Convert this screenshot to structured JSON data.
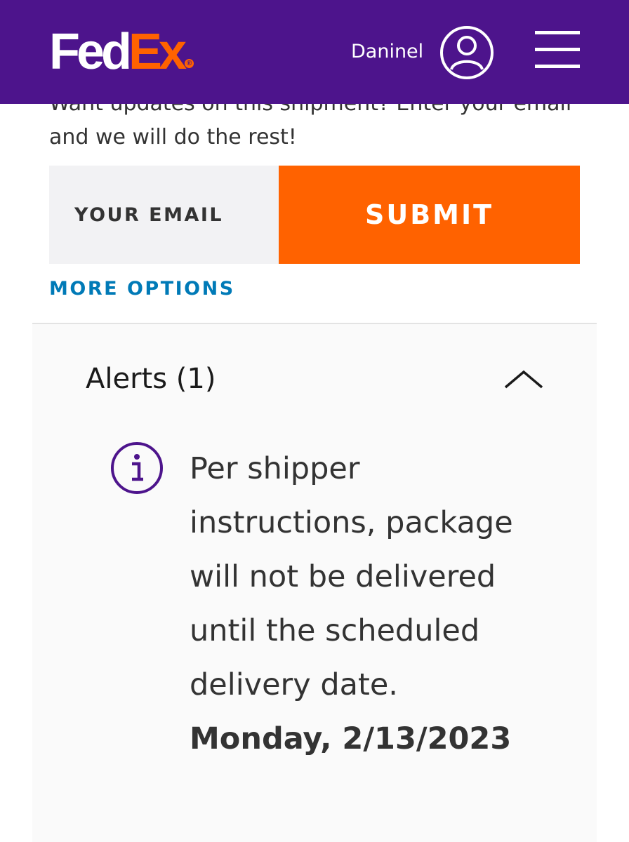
{
  "header": {
    "logo_fed": "Fed",
    "logo_ex": "Ex",
    "logo_reg": "®",
    "username": "Daninel",
    "avatar_icon": "user-circle-icon",
    "menu_icon": "hamburger-menu-icon",
    "background_color": "#4d148c"
  },
  "updates": {
    "prompt": "Want updates on this shipment? Enter your email and we will do the rest!",
    "email_placeholder": "YOUR EMAIL",
    "submit_label": "SUBMIT",
    "more_options_label": "MORE OPTIONS",
    "submit_color": "#ff6200",
    "link_color": "#007ab7"
  },
  "alerts": {
    "title": "Alerts (1)",
    "toggle_icon": "chevron-up-icon",
    "items": [
      {
        "icon": "info-icon",
        "message": "Per shipper instructions, package will not be delivered until the scheduled delivery date.",
        "date": "Monday, 2/13/2023"
      }
    ]
  }
}
